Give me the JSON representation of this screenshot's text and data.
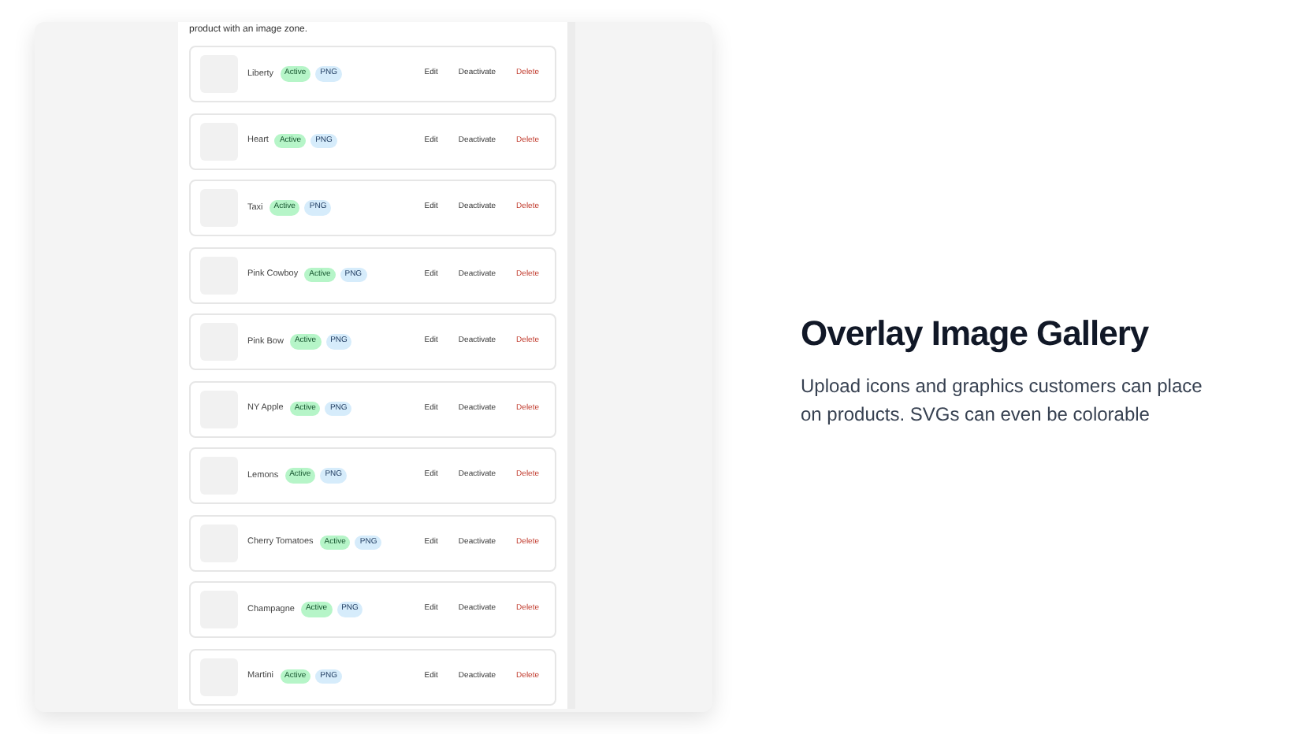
{
  "intro": "product with an image zone.",
  "items": [
    {
      "name": "Liberty",
      "status": "Active",
      "format": "PNG",
      "actions": [
        {
          "label": "Edit",
          "danger": false
        },
        {
          "label": "Deactivate",
          "danger": false
        },
        {
          "label": "Delete",
          "danger": true
        }
      ]
    },
    {
      "name": "Heart",
      "status": "Active",
      "format": "PNG",
      "actions": [
        {
          "label": "Edit",
          "danger": false
        },
        {
          "label": "Deactivate",
          "danger": false
        },
        {
          "label": "Delete",
          "danger": true
        }
      ]
    },
    {
      "name": "Taxi",
      "status": "Active",
      "format": "PNG",
      "actions": [
        {
          "label": "Edit",
          "danger": false
        },
        {
          "label": "Deactivate",
          "danger": false
        },
        {
          "label": "Delete",
          "danger": true
        }
      ]
    },
    {
      "name": "Pink Cowboy",
      "status": "Active",
      "format": "PNG",
      "actions": [
        {
          "label": "Edit",
          "danger": false
        },
        {
          "label": "Deactivate",
          "danger": false
        },
        {
          "label": "Delete",
          "danger": true
        }
      ]
    },
    {
      "name": "Pink Bow",
      "status": "Active",
      "format": "PNG",
      "actions": [
        {
          "label": "Edit",
          "danger": false
        },
        {
          "label": "Deactivate",
          "danger": false
        },
        {
          "label": "Delete",
          "danger": true
        }
      ]
    },
    {
      "name": "NY Apple",
      "status": "Active",
      "format": "PNG",
      "actions": [
        {
          "label": "Edit",
          "danger": false
        },
        {
          "label": "Deactivate",
          "danger": false
        },
        {
          "label": "Delete",
          "danger": true
        }
      ]
    },
    {
      "name": "Lemons",
      "status": "Active",
      "format": "PNG",
      "actions": [
        {
          "label": "Edit",
          "danger": false
        },
        {
          "label": "Deactivate",
          "danger": false
        },
        {
          "label": "Delete",
          "danger": true
        }
      ]
    },
    {
      "name": "Cherry Tomatoes",
      "status": "Active",
      "format": "PNG",
      "actions": [
        {
          "label": "Edit",
          "danger": false
        },
        {
          "label": "Deactivate",
          "danger": false
        },
        {
          "label": "Delete",
          "danger": true
        }
      ]
    },
    {
      "name": "Champagne",
      "status": "Active",
      "format": "PNG",
      "actions": [
        {
          "label": "Edit",
          "danger": false
        },
        {
          "label": "Deactivate",
          "danger": false
        },
        {
          "label": "Delete",
          "danger": true
        }
      ]
    },
    {
      "name": "Martini",
      "status": "Active",
      "format": "PNG",
      "actions": [
        {
          "label": "Edit",
          "danger": false
        },
        {
          "label": "Deactivate",
          "danger": false
        },
        {
          "label": "Delete",
          "danger": true
        }
      ]
    }
  ],
  "feature": {
    "title": "Overlay Image Gallery",
    "description": "Upload icons and graphics customers can place on products. SVGs can even be colorable"
  }
}
